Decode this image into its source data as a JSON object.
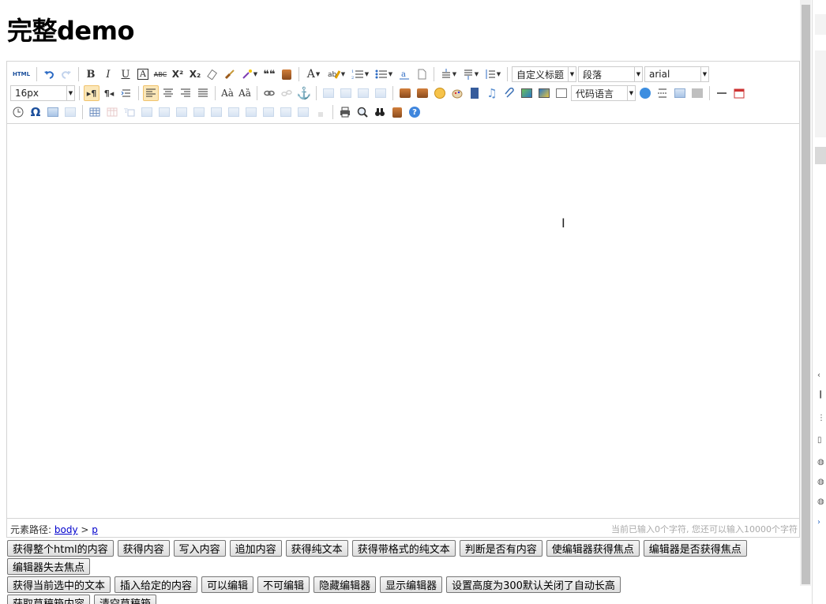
{
  "page_title": "完整demo",
  "toolbar": {
    "source": "HTML",
    "bold": "B",
    "italic": "I",
    "underline": "U",
    "fontborder": "A",
    "strikethrough": "ABC",
    "superscript": "X²",
    "subscript": "X₂",
    "forecolor": "A",
    "customstyle": "自定义标题",
    "paragraph": "段落",
    "fontfamily": "arial",
    "fontsize": "16px",
    "insertcode": "代码语言",
    "blockquote": "❝❝",
    "omega": "Ω",
    "help": "?",
    "icons": {
      "undo": "undo-icon",
      "redo": "redo-icon",
      "removeformat": "eraser-icon",
      "formatmatch": "brush-icon",
      "autotypeset": "magic-wand-icon",
      "pasteplain": "paste-text-icon",
      "backcolor": "highlighter-icon",
      "insertorderedlist": "ordered-list-icon",
      "insertunorderedlist": "unordered-list-icon",
      "selectall": "select-all-icon",
      "cleardoc": "blank-page-icon",
      "rowspacingtop": "row-spacing-top-icon",
      "rowspacingbottom": "row-spacing-bottom-icon",
      "lineheight": "line-height-icon",
      "link": "link-icon",
      "unlink": "unlink-icon",
      "anchor": "anchor-icon",
      "emotion": "emoji-icon",
      "print": "print-icon",
      "preview": "preview-icon",
      "searchreplace": "binoculars-icon",
      "drafts": "drafts-icon",
      "time": "clock-icon",
      "date": "calendar-icon",
      "horizontal": "horizontal-rule-icon",
      "inserttable": "table-icon"
    }
  },
  "editor": {
    "path_label": "元素路径:",
    "path_body": "body",
    "path_sep": ">",
    "path_p": "p",
    "wordcount": "当前已输入0个字符, 您还可以输入10000个字符"
  },
  "buttons": {
    "row1": [
      "获得整个html的内容",
      "获得内容",
      "写入内容",
      "追加内容",
      "获得纯文本",
      "获得带格式的纯文本",
      "判断是否有内容",
      "使编辑器获得焦点",
      "编辑器是否获得焦点"
    ],
    "row2": [
      "编辑器失去焦点"
    ],
    "row3": [
      "获得当前选中的文本",
      "插入给定的内容",
      "可以编辑",
      "不可编辑",
      "隐藏编辑器",
      "显示编辑器",
      "设置高度为300默认关闭了自动长高"
    ],
    "row4": [
      "获取草稿箱内容",
      "清空草稿箱"
    ]
  }
}
